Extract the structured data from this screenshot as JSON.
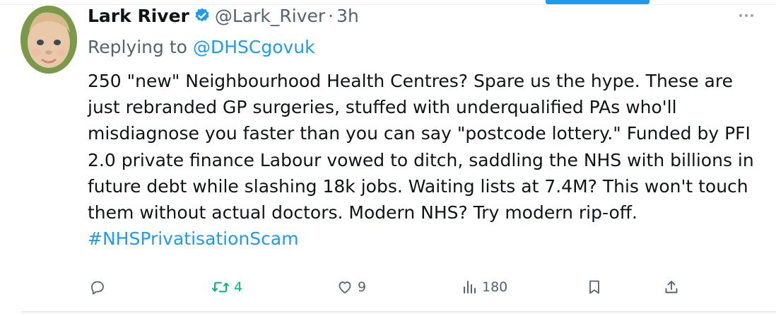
{
  "author": {
    "display_name": "Lark River",
    "handle": "@Lark_River",
    "separator": "·",
    "time": "3h"
  },
  "reply": {
    "prefix": "Replying to",
    "mention": "@DHSCgovuk"
  },
  "tweet": {
    "text": "250 \"new\" Neighbourhood Health Centres? Spare us the hype. These are just rebranded GP surgeries, stuffed with underqualified PAs who'll misdiagnose you faster than you can say \"postcode lottery.\" Funded by PFI 2.0 private finance Labour vowed to ditch, saddling the NHS with billions in future debt while slashing 18k jobs. Waiting lists at 7.4M? This won't touch them without actual doctors. Modern NHS? Try modern rip-off.",
    "hashtag": "#NHSPrivatisationScam"
  },
  "actions": {
    "reply_count": "",
    "repost_count": "4",
    "like_count": "9",
    "view_count": "180"
  },
  "colors": {
    "accent": "#1d9bf0",
    "repost_active": "#00ba7c",
    "muted": "#536471",
    "text": "#0f1419"
  },
  "icons": {
    "verified": "verified-badge-icon",
    "more": "more-dots-icon",
    "reply": "reply-icon",
    "repost": "repost-icon",
    "like": "heart-icon",
    "views": "views-chart-icon",
    "bookmark": "bookmark-icon",
    "share": "share-icon"
  }
}
